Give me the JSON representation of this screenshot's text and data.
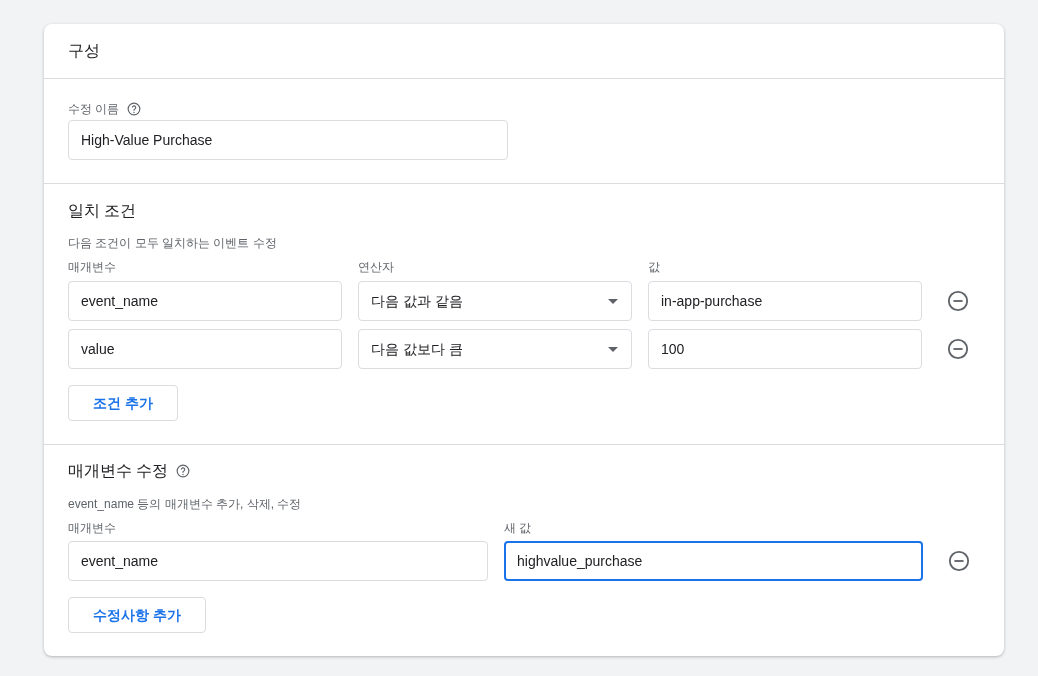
{
  "card": {
    "title": "구성"
  },
  "name_section": {
    "label": "수정 이름",
    "value": "High-Value Purchase"
  },
  "conditions": {
    "title": "일치 조건",
    "description": "다음 조건이 모두 일치하는 이벤트 수정",
    "columns": [
      "매개변수",
      "연산자",
      "값"
    ],
    "rows": [
      {
        "parameter": "event_name",
        "operator": "다음 값과 같음",
        "value": "in-app-purchase"
      },
      {
        "parameter": "value",
        "operator": "다음 값보다 큼",
        "value": "100"
      }
    ],
    "add_button": "조건 추가"
  },
  "modifications": {
    "title": "매개변수 수정",
    "description": "event_name 등의 매개변수 추가, 삭제, 수정",
    "columns": [
      "매개변수",
      "새 값"
    ],
    "rows": [
      {
        "parameter": "event_name",
        "new_value": "highvalue_purchase",
        "focused": true
      }
    ],
    "add_button": "수정사항 추가"
  }
}
